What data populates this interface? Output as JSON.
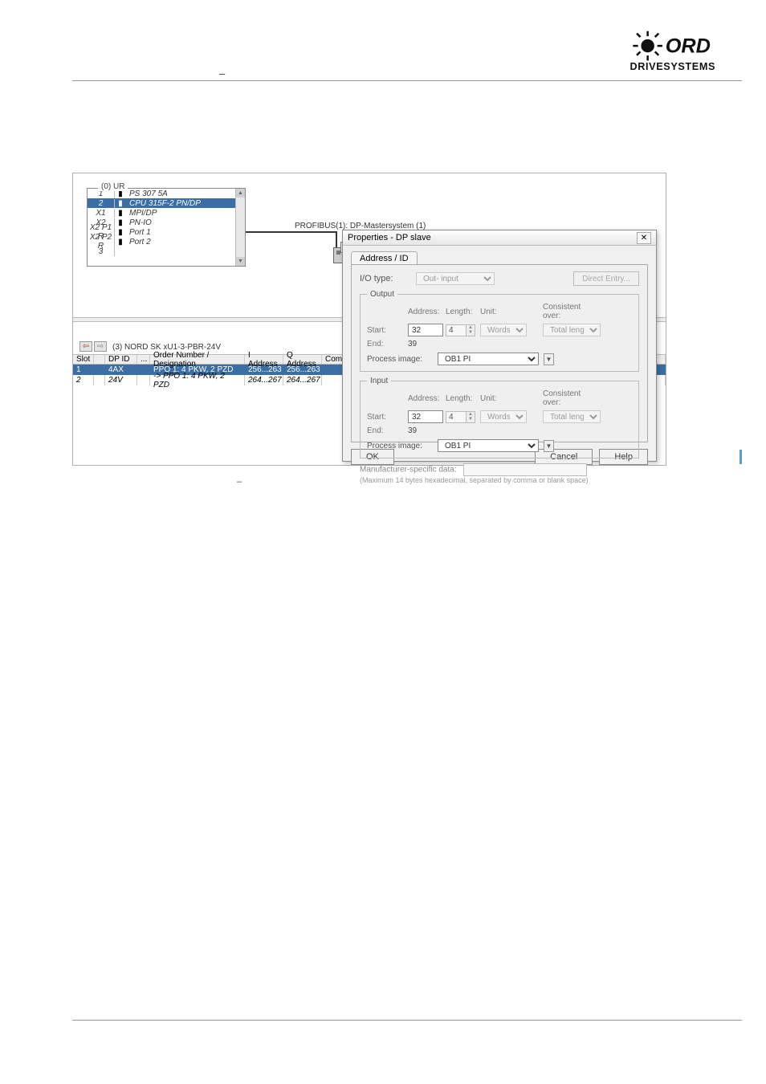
{
  "header": {
    "doc_line": "",
    "dash": "–"
  },
  "rack": {
    "title": "(0) UR",
    "rows": [
      {
        "num": "1",
        "label": "PS 307 5A",
        "sel": false
      },
      {
        "num": "2",
        "label": "CPU 315F-2 PN/DP",
        "sel": true
      },
      {
        "num": "X1",
        "label": "MPI/DP",
        "sel": false
      },
      {
        "num": "X2",
        "label": "PN-IO",
        "sel": false
      },
      {
        "num": "X2 P1 R",
        "label": "Port 1",
        "sel": false
      },
      {
        "num": "X2 P2 R",
        "label": "Port 2",
        "sel": false
      },
      {
        "num": "3",
        "label": "",
        "sel": false
      }
    ]
  },
  "bus_label": "PROFIBUS(1): DP-Mastersystem (1)",
  "slave": {
    "title": "(3)  NORD SK xU1-3-PBR-24V",
    "head": [
      "Slot",
      "",
      "DP ID",
      "...",
      "Order Number / Designation",
      "I Address",
      "Q Address",
      "Comment"
    ],
    "rows": [
      {
        "c1": "1",
        "c3": "4AX",
        "c5": "PPO 1:   4 PKW, 2 PZD",
        "c6": "256...263",
        "c7": "256...263",
        "sel": true
      },
      {
        "c1": "2",
        "c3": "24V",
        "c5": "-> PPO 1:   4 PKW, 2 PZD",
        "c6": "264...267",
        "c7": "264...267",
        "sel": false
      }
    ]
  },
  "dlg": {
    "title": "Properties - DP slave",
    "tab": "Address / ID",
    "io_type_label": "I/O type:",
    "io_type_value": "Out- input",
    "direct_entry": "Direct Entry...",
    "groups": {
      "output": {
        "legend": "Output",
        "addr_h": "Address:",
        "len_h": "Length:",
        "unit_h": "Unit:",
        "cons_h": "Consistent over:",
        "start_l": "Start:",
        "start_v": "32",
        "len_v": "4",
        "unit_v": "Words",
        "cons_v": "Total length",
        "end_l": "End:",
        "end_v": "39",
        "pi_l": "Process image:",
        "pi_v": "OB1 PI"
      },
      "input": {
        "legend": "Input",
        "addr_h": "Address:",
        "len_h": "Length:",
        "unit_h": "Unit:",
        "cons_h": "Consistent over:",
        "start_l": "Start:",
        "start_v": "32",
        "len_v": "4",
        "unit_v": "Words",
        "cons_v": "Total length",
        "end_l": "End:",
        "end_v": "39",
        "pi_l": "Process image:",
        "pi_v": "OB1 PI"
      }
    },
    "manu_l": "Manufacturer-specific data:",
    "manu_note": "(Maximum 14 bytes hexadecimal, separated by comma or blank space)",
    "ok": "OK",
    "cancel": "Cancel",
    "help": "Help"
  },
  "fig_caption": {
    "dash": "–"
  }
}
